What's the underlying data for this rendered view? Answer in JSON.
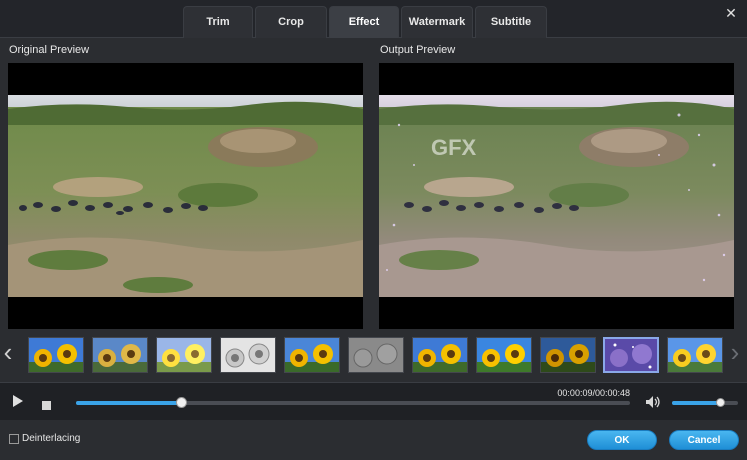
{
  "tabs": [
    {
      "label": "Trim",
      "active": false
    },
    {
      "label": "Crop",
      "active": false
    },
    {
      "label": "Effect",
      "active": true
    },
    {
      "label": "Watermark",
      "active": false
    },
    {
      "label": "Subtitle",
      "active": false
    }
  ],
  "close_icon": "close-icon",
  "preview": {
    "original_label": "Original Preview",
    "output_label": "Output Preview",
    "watermark_text": "GFX"
  },
  "filters": {
    "left_arrow": "chevron-left-icon",
    "right_arrow": "chevron-right-icon",
    "selected_index": 9,
    "count": 11
  },
  "playback": {
    "time": "00:00:09/00:00:48",
    "progress_fraction": 0.19,
    "volume_fraction": 0.73,
    "play_icon": "play-icon",
    "stop_icon": "stop-icon",
    "volume_icon": "volume-icon"
  },
  "footer": {
    "deinterlacing_label": "Deinterlacing",
    "deinterlacing_checked": false,
    "ok_label": "OK",
    "cancel_label": "Cancel"
  },
  "colors": {
    "accent": "#3aa3e8",
    "background": "#2b2d31"
  }
}
